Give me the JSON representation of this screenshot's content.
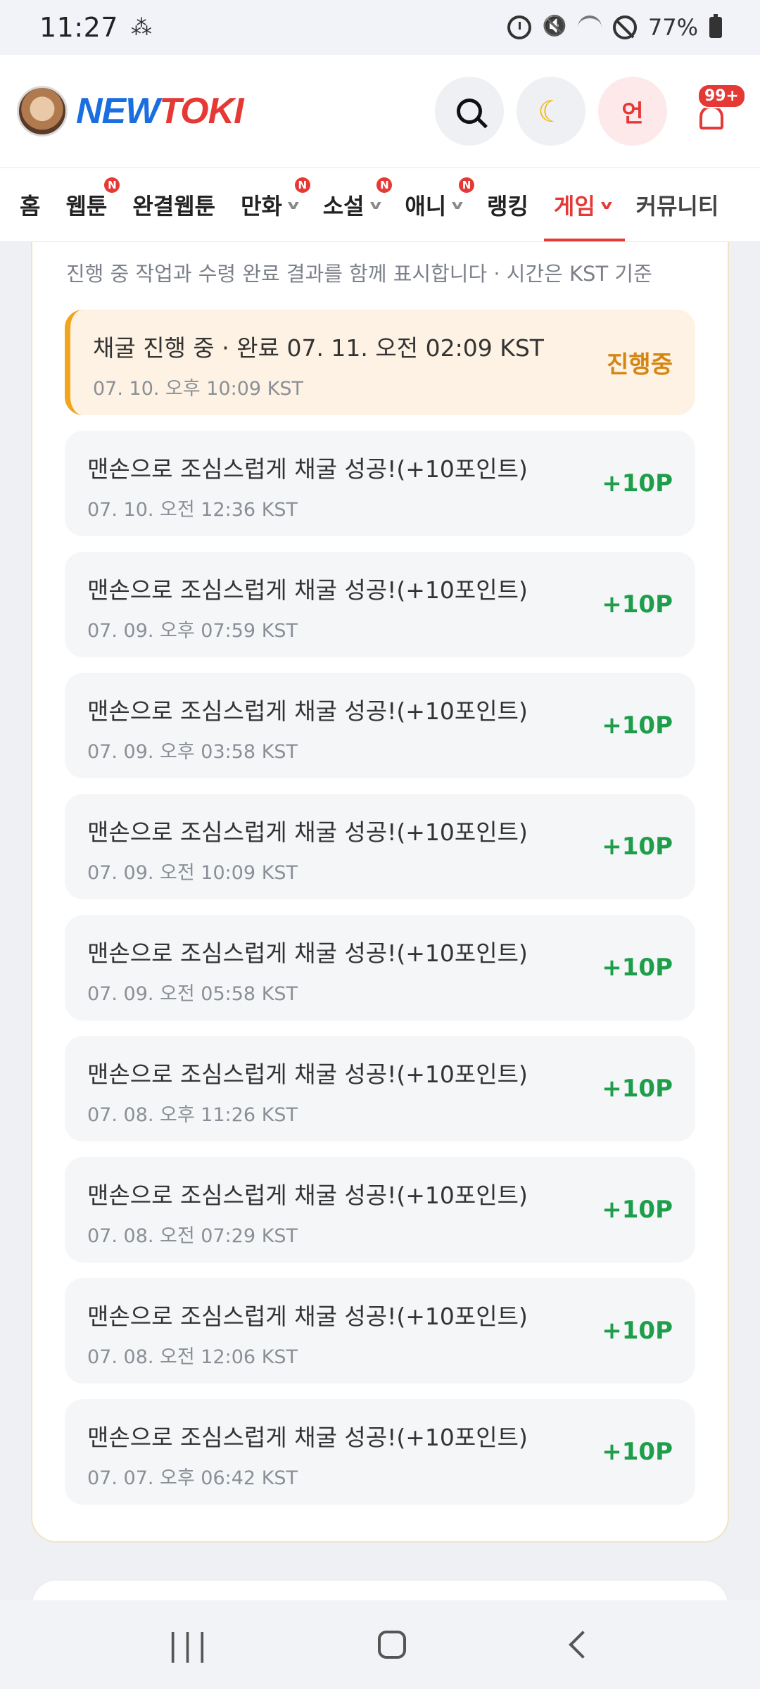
{
  "status": {
    "time": "11:27",
    "battery": "77%",
    "icons": [
      "grid-icon",
      "alarm-icon",
      "mute-icon",
      "wifi-icon",
      "dnd-icon",
      "battery-icon"
    ]
  },
  "header": {
    "logo_new": "NEW",
    "logo_toki": "TOKI",
    "user_label": "언",
    "notification_count": "99+"
  },
  "nav": {
    "tabs": [
      {
        "label": "홈"
      },
      {
        "label": "웹툰"
      },
      {
        "label": "완결웹툰"
      },
      {
        "label": "만화"
      },
      {
        "label": "소설"
      },
      {
        "label": "애니"
      },
      {
        "label": "랭킹"
      },
      {
        "label": "게임"
      },
      {
        "label": "커뮤니티"
      }
    ],
    "badge": "N"
  },
  "card": {
    "subtitle": "진행 중 작업과 수령 완료 결과를 함께 표시합니다 · 시간은 KST 기준",
    "items": [
      {
        "title": "채굴 진행 중 · 완료 07. 11. 오전 02:09 KST",
        "date": "07. 10. 오후 10:09 KST",
        "points": "진행중"
      },
      {
        "title": "맨손으로 조심스럽게 채굴 성공!(+10포인트)",
        "date": "07. 10. 오전 12:36 KST",
        "points": "+10P"
      },
      {
        "title": "맨손으로 조심스럽게 채굴 성공!(+10포인트)",
        "date": "07. 09. 오후 07:59 KST",
        "points": "+10P"
      },
      {
        "title": "맨손으로 조심스럽게 채굴 성공!(+10포인트)",
        "date": "07. 09. 오후 03:58 KST",
        "points": "+10P"
      },
      {
        "title": "맨손으로 조심스럽게 채굴 성공!(+10포인트)",
        "date": "07. 09. 오전 10:09 KST",
        "points": "+10P"
      },
      {
        "title": "맨손으로 조심스럽게 채굴 성공!(+10포인트)",
        "date": "07. 09. 오전 05:58 KST",
        "points": "+10P"
      },
      {
        "title": "맨손으로 조심스럽게 채굴 성공!(+10포인트)",
        "date": "07. 08. 오후 11:26 KST",
        "points": "+10P"
      },
      {
        "title": "맨손으로 조심스럽게 채굴 성공!(+10포인트)",
        "date": "07. 08. 오전 07:29 KST",
        "points": "+10P"
      },
      {
        "title": "맨손으로 조심스럽게 채굴 성공!(+10포인트)",
        "date": "07. 08. 오전 12:06 KST",
        "points": "+10P"
      },
      {
        "title": "맨손으로 조심스럽게 채굴 성공!(+10포인트)",
        "date": "07. 07. 오후 06:42 KST",
        "points": "+10P"
      }
    ]
  },
  "colors": {
    "accent": "#e53935",
    "logo_blue": "#1a6fe0",
    "reward_green": "#1e9e4a",
    "progress_orange": "#d58512"
  }
}
